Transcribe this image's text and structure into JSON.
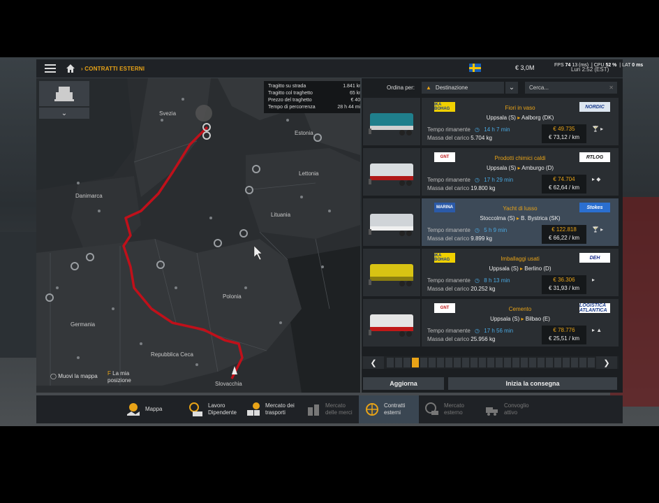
{
  "topbar": {
    "breadcrumb": "CONTRATTI ESTERNI",
    "money": "€ 3,0M",
    "fps_label": "FPS",
    "fps_value": "74",
    "frame": "13 (ms)",
    "cpu_label": "CPU",
    "cpu_value": "52 %",
    "lat_label": "LAT",
    "lat_value": "0 ms",
    "time": "Lun 2:52 (EST)"
  },
  "map": {
    "route_info": [
      {
        "label": "Tragitto su strada",
        "value": "1.841 km"
      },
      {
        "label": "Tragitto col traghetto",
        "value": "65 km"
      },
      {
        "label": "Prezzo del traghetto",
        "value": "€ 404"
      },
      {
        "label": "Tempo di percorrenza",
        "value": "28 h 44 min"
      }
    ],
    "labels": {
      "svezia": "Svezia",
      "estonia": "Estonia",
      "lettonia": "Lettonia",
      "danimarca": "Danimarca",
      "lituania": "Lituania",
      "polonia": "Polonia",
      "germania": "Germania",
      "rep_ceca": "Repubblica Ceca",
      "slovacchia": "Slovacchia"
    },
    "hint_move": "Muovi la mappa",
    "hint_key": "F",
    "hint_pos": "La mia posizione"
  },
  "sort": {
    "label": "Ordina per:",
    "value": "Destinazione",
    "search_placeholder": "Cerca..."
  },
  "jobs": [
    {
      "cargo": "Fiori in vaso",
      "from": "Uppsala (S)",
      "to": "Aalborg (DK)",
      "time_label": "Tempo rimanente",
      "time": "14 h 7 min",
      "mass_label": "Massa del carico",
      "mass": "5.704 kg",
      "price": "€ 49.735",
      "per_km": "€ 73,12 / km",
      "logo_left": "IKA BOHAG",
      "logo_right": "NORDIC",
      "icons": "🍸 ▸"
    },
    {
      "cargo": "Prodotti chimici caldi",
      "from": "Uppsala (S)",
      "to": "Amburgo (D)",
      "time_label": "Tempo rimanente",
      "time": "17 h 29 min",
      "mass_label": "Massa del carico",
      "mass": "19.800 kg",
      "price": "€ 74.704",
      "per_km": "€ 62,64 / km",
      "logo_left": "GNT",
      "logo_right": "RTLOG",
      "icons": "▸ ◆"
    },
    {
      "cargo": "Yacht di lusso",
      "from": "Stoccolma (S)",
      "to": "B. Bystrica (SK)",
      "time_label": "Tempo rimanente",
      "time": "5 h 9 min",
      "mass_label": "Massa del carico",
      "mass": "9.899 kg",
      "price": "€ 122.818",
      "per_km": "€ 66,22 / km",
      "logo_left": "MARINA",
      "logo_right": "Stokes",
      "icons": "🍸 ▸"
    },
    {
      "cargo": "Imballaggi usati",
      "from": "Uppsala (S)",
      "to": "Berlino (D)",
      "time_label": "Tempo rimanente",
      "time": "8 h 13 min",
      "mass_label": "Massa del carico",
      "mass": "20.252 kg",
      "price": "€ 36.306",
      "per_km": "€ 31,93 / km",
      "logo_left": "IKA BOHAG",
      "logo_right": "DEH",
      "icons": "▸"
    },
    {
      "cargo": "Cemento",
      "from": "Uppsala (S)",
      "to": "Bilbao (E)",
      "time_label": "Tempo rimanente",
      "time": "17 h 56 min",
      "mass_label": "Massa del carico",
      "mass": "25.956 kg",
      "price": "€ 78.776",
      "per_km": "€ 25,51 / km",
      "logo_left": "GNT",
      "logo_right": "LOGISTICA ATLANTICA",
      "icons": "▸ ▲"
    }
  ],
  "buttons": {
    "refresh": "Aggiorna",
    "start": "Inizia la consegna"
  },
  "bottom_nav": [
    {
      "label": "Mappa",
      "icon": "map-icon",
      "state": "normal"
    },
    {
      "label": "Lavoro Dipendente",
      "icon": "clock-icon",
      "state": "normal"
    },
    {
      "label": "Mercato dei trasporti",
      "icon": "market-icon",
      "state": "normal"
    },
    {
      "label": "Mercato delle merci",
      "icon": "cargo-icon",
      "state": "dim"
    },
    {
      "label": "Contratti esterni",
      "icon": "globe-icon",
      "state": "active"
    },
    {
      "label": "Mercato esterno",
      "icon": "globe-truck-icon",
      "state": "dim"
    },
    {
      "label": "Convoglio attivo",
      "icon": "convoy-icon",
      "state": "dim"
    }
  ],
  "colors": {
    "accent": "#e8a317",
    "route": "#c0101a",
    "time": "#4aa8e0"
  }
}
